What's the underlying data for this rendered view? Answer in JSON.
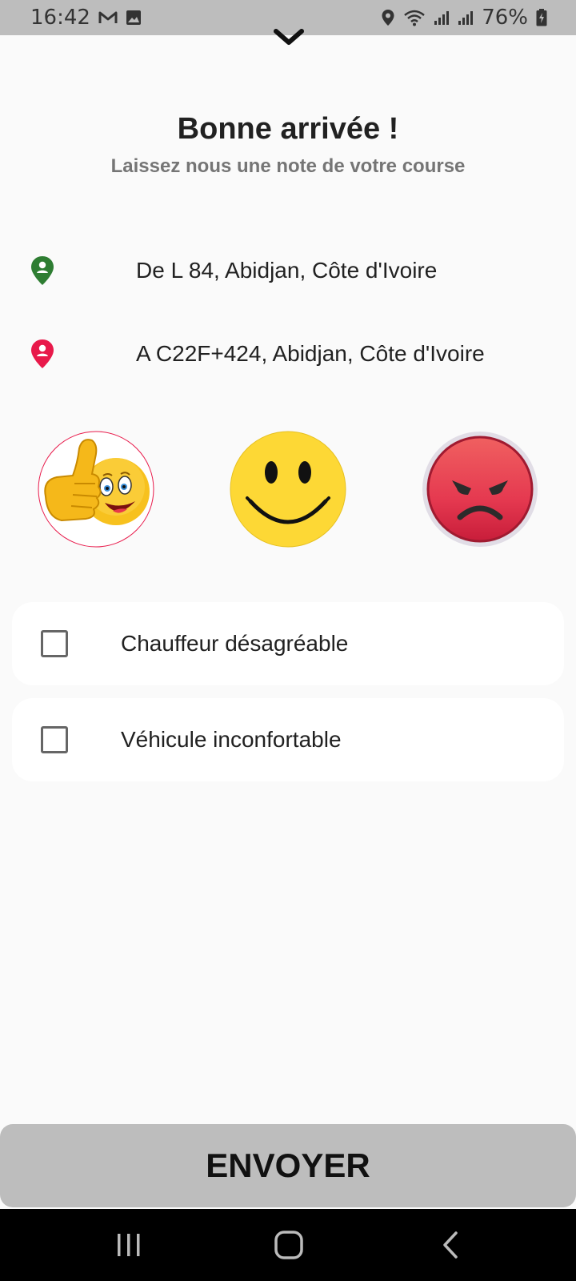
{
  "status_bar": {
    "time": "16:42",
    "battery": "76%",
    "icons": [
      "gmail-icon",
      "image-icon",
      "location-icon",
      "wifi-icon",
      "signal-icon",
      "signal-icon-2",
      "battery-charging-icon"
    ]
  },
  "header": {
    "title": "Bonne arrivée !",
    "subtitle": "Laissez nous une note de votre course"
  },
  "trip": {
    "from": "De L 84, Abidjan, Côte d'Ivoire",
    "to": "A C22F+424, Abidjan, Côte d'Ivoire",
    "from_color": "#2e7d32",
    "to_color": "#e8194a"
  },
  "ratings": {
    "options": [
      "thumbs-up-emoji",
      "smiley-emoji",
      "angry-emoji"
    ],
    "selected": "thumbs-up-emoji"
  },
  "complaints": [
    {
      "label": "Chauffeur désagréable",
      "checked": false
    },
    {
      "label": "Véhicule inconfortable",
      "checked": false
    }
  ],
  "actions": {
    "send_label": "ENVOYER"
  },
  "nav": {
    "icons": [
      "recents-icon",
      "home-icon",
      "back-icon"
    ]
  }
}
